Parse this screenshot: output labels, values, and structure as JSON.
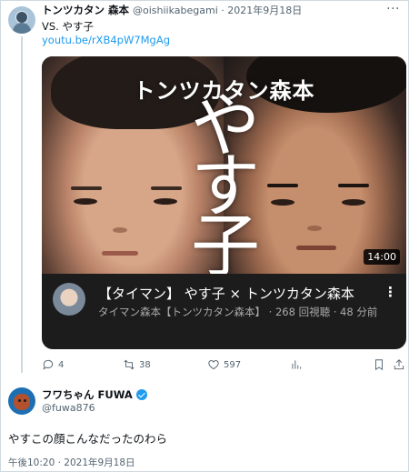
{
  "tweet1": {
    "author_name": "トンツカタン 森本",
    "handle": "@oishiikabegami",
    "separator": "·",
    "date": "2021年9月18日",
    "text": "VS. やす子",
    "link": "youtu.be/rXB4pW7MgAg",
    "more_icon": "more-dots-icon",
    "video": {
      "thumb_title": "トンツカタン森本",
      "thumb_big_text": "やす子",
      "duration": "14:00",
      "title": "【タイマン】 やす子 × トンツカタン森本",
      "meta": "タイマン森本【トンツカタン森本】 · 268 回視聴 · 48 分前",
      "more_label": "⋮"
    },
    "actions": {
      "reply_count": "4",
      "retweet_count": "38",
      "like_count": "597"
    }
  },
  "tweet2": {
    "author_name": "フワちゃん FUWA",
    "handle": "@fuwa876",
    "text": "やすこの顔こんなだったのわら",
    "timestamp": "午後10:20 · 2021年9月18日"
  },
  "colors": {
    "link": "#1d9bf0",
    "secondary_text": "#536471",
    "card_bg": "#1c1c1c"
  }
}
